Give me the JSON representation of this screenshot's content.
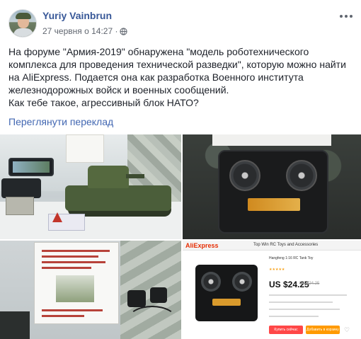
{
  "post": {
    "author": "Yuriy Vainbrun",
    "timestamp": "27 червня о 14:27 · ",
    "privacy_icon": "globe-icon",
    "more_icon": "more-options-icon",
    "text_lines": [
      "На форуме \"Армия-2019\" обнаружена \"модель роботехнического",
      "комплекса для проведения технической разведки\", которую можно найти",
      "на AliExpress. Подается она как разработка Военного института",
      "железнодорожных войск и военных сообщений.",
      "Как тебе такое, агрессивный блок НАТО?"
    ],
    "translate_link": "Переглянути переклад"
  },
  "photo_grid": {
    "ali": {
      "logo": "AliExpress",
      "store": "Top Win RC Toys and Accessories",
      "title": "Hangfeng 1:16 RC Tank Toy",
      "rating": "★★★★★",
      "price": "US $24.25",
      "old_price": "US $24.25",
      "buy": "Купить сейчас",
      "cart": "Добавить в корзину",
      "heart": "♡"
    }
  },
  "colors": {
    "link": "#385898",
    "translate": "#4267b2",
    "ali_red": "#e62e04"
  }
}
